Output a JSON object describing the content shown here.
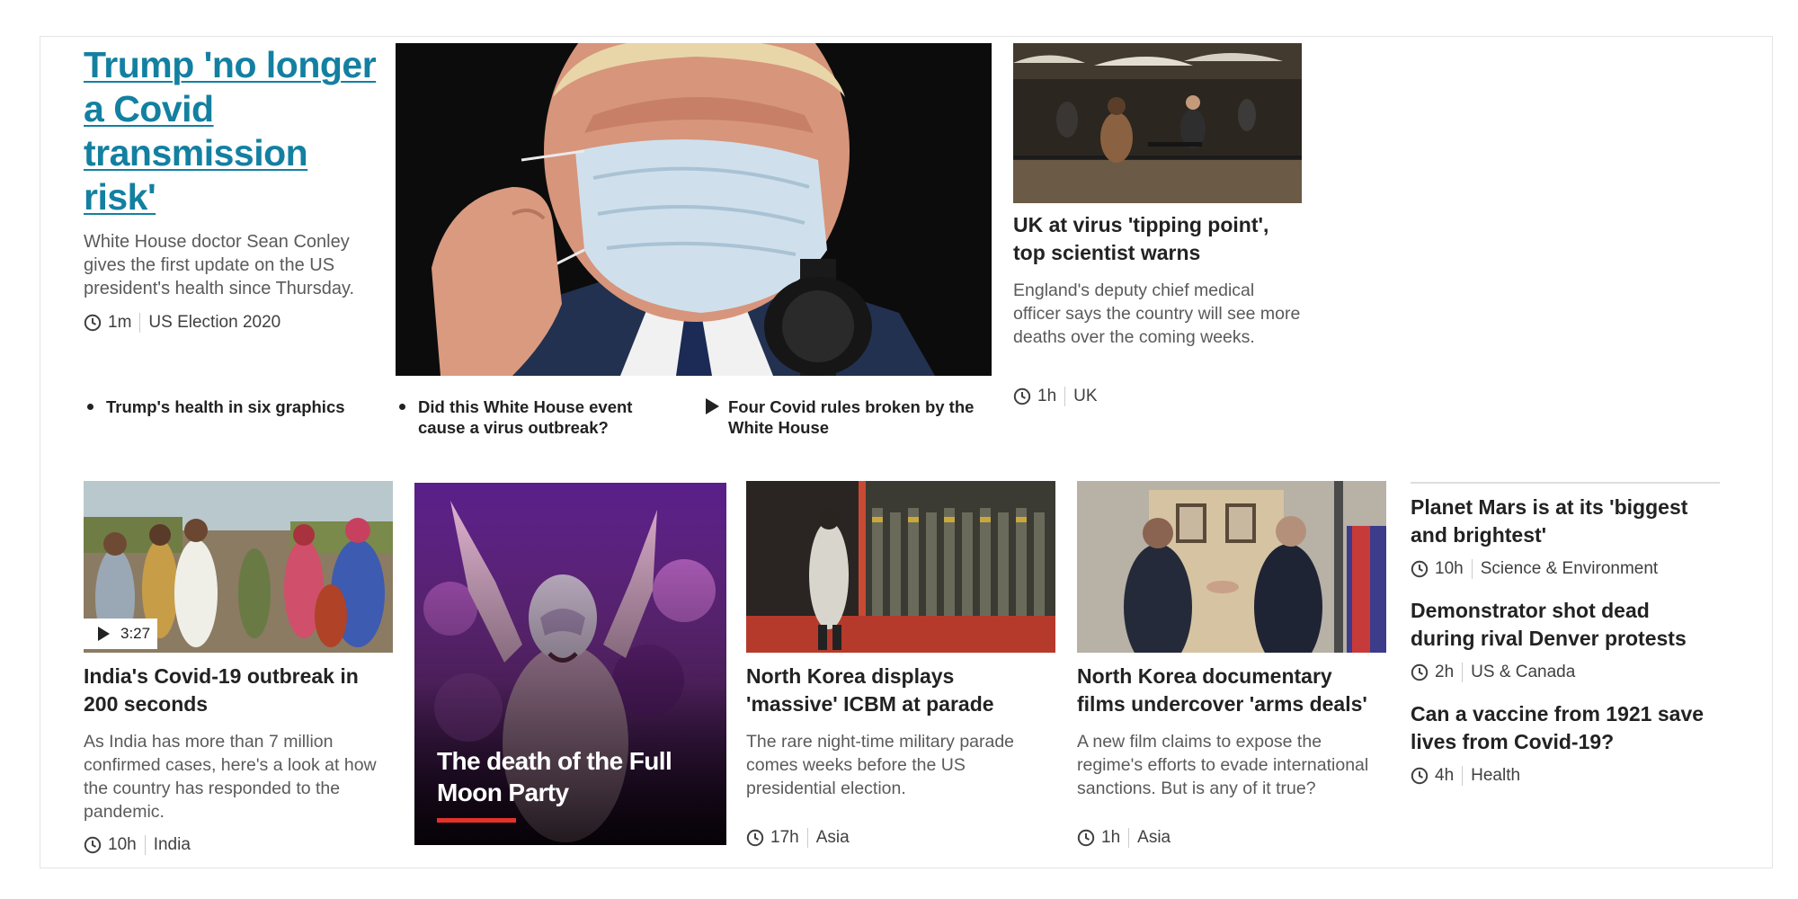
{
  "lead": {
    "title": "Trump 'no longer a Covid transmission risk'",
    "summary": "White House doctor Sean Conley gives the first update on the US president's health since Thursday.",
    "time": "1m",
    "section": "US Election 2020"
  },
  "related": [
    {
      "label": "Trump's health in six graphics",
      "icon": "bullet"
    },
    {
      "label": "Did this White House event cause a virus outbreak?",
      "icon": "bullet"
    },
    {
      "label": "Four Covid rules broken by the White House",
      "icon": "play-icon"
    }
  ],
  "uk_story": {
    "title": "UK at virus 'tipping point', top scientist warns",
    "summary": "England's deputy chief medical officer says the country will see more deaths over the coming weeks.",
    "time": "1h",
    "section": "UK"
  },
  "cards": [
    {
      "title": "India's Covid-19 outbreak in 200 seconds",
      "summary": "As India has more than 7 million confirmed cases, here's a look at how the country has responded to the pandemic.",
      "time": "10h",
      "section": "India",
      "duration": "3:27"
    },
    {
      "title": "North Korea displays 'massive' ICBM at parade",
      "summary": "The rare night-time military parade comes weeks before the US presidential election.",
      "time": "17h",
      "section": "Asia"
    },
    {
      "title": "North Korea documentary films undercover 'arms deals'",
      "summary": "A new film claims to expose the regime's efforts to evade international sanctions. But is any of it true?",
      "time": "1h",
      "section": "Asia"
    }
  ],
  "feature": {
    "title": "The death of the Full Moon Party"
  },
  "side_stories": [
    {
      "title": "Planet Mars is at its 'biggest and brightest'",
      "time": "10h",
      "section": "Science & Environment"
    },
    {
      "title": "Demonstrator shot dead during rival Denver protests",
      "time": "2h",
      "section": "US & Canada"
    },
    {
      "title": "Can a vaccine from 1921 save lives from Covid-19?",
      "time": "4h",
      "section": "Health"
    }
  ],
  "colors": {
    "link": "#1380a1",
    "accent_bar": "#e4322b",
    "meta_text": "#404040",
    "summary_text": "#5a5a5a"
  }
}
